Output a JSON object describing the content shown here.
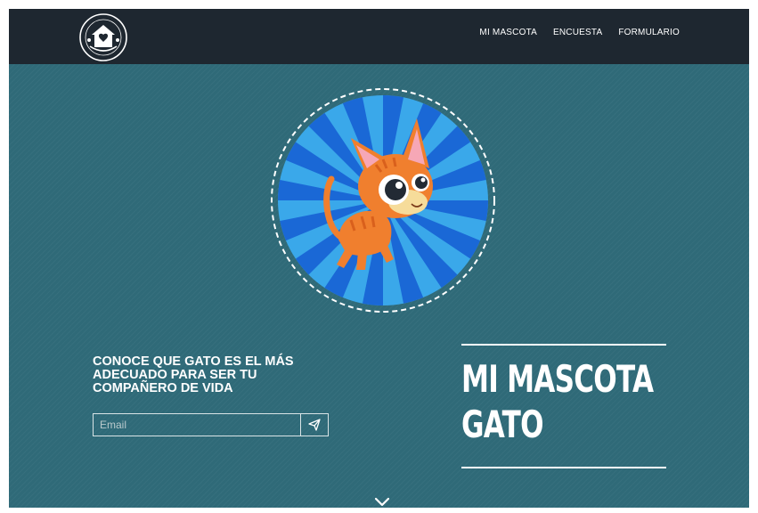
{
  "nav": {
    "logo_alt": "ANIMALS CATS",
    "links": [
      "MI MASCOTA",
      "ENCUESTA",
      "FORMULARIO"
    ]
  },
  "hero": {
    "tagline": "CONOCE QUE GATO ES EL MÁS ADECUADO PARA SER TU COMPAÑERO DE VIDA",
    "email_placeholder": "Email",
    "send_icon": "paper-plane-icon",
    "title_line1": "MI MASCOTA",
    "title_line2": "GATO",
    "scroll_icon": "chevron-down-icon"
  },
  "colors": {
    "navbar": "#1e2730",
    "background": "#2f6a78",
    "badge_blue": "#1a68d6",
    "badge_light": "#3aa8ea",
    "cat_orange": "#f07f2e"
  }
}
